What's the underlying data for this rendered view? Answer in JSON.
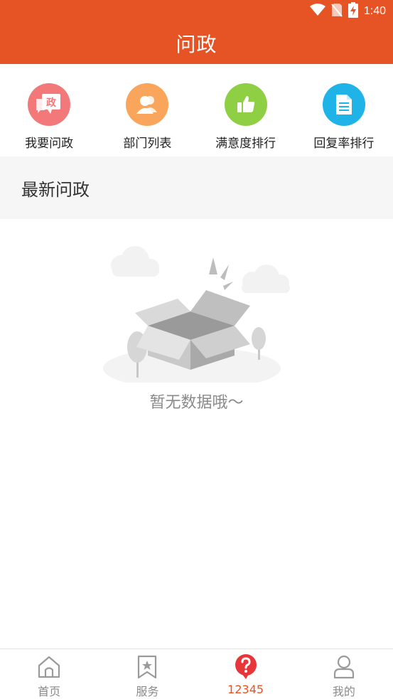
{
  "status_bar": {
    "time": "1:40",
    "icons": [
      "wifi-icon",
      "no-sim-icon",
      "battery-charging-icon"
    ]
  },
  "header": {
    "title": "问政"
  },
  "quick_menu": [
    {
      "label": "我要问政",
      "icon": "politics-speech-icon",
      "badge": "政",
      "color": "#F3787A"
    },
    {
      "label": "部门列表",
      "icon": "people-icon",
      "color": "#F9A65C"
    },
    {
      "label": "满意度排行",
      "icon": "thumbs-up-icon",
      "color": "#8ECF44"
    },
    {
      "label": "回复率排行",
      "icon": "document-icon",
      "color": "#1FB3E8"
    }
  ],
  "section": {
    "title": "最新问政"
  },
  "empty_state": {
    "text": "暂无数据哦～",
    "illustration": "empty-box-illustration"
  },
  "tabs": [
    {
      "label": "首页",
      "icon": "home-icon",
      "active": false
    },
    {
      "label": "服务",
      "icon": "star-bookmark-icon",
      "active": false
    },
    {
      "label": "12345",
      "icon": "question-bubble-icon",
      "active": true
    },
    {
      "label": "我的",
      "icon": "user-icon",
      "active": false
    }
  ],
  "colors": {
    "accent": "#E65325",
    "section_bg": "#F6F6F6",
    "muted_text": "#8A8A8A"
  }
}
